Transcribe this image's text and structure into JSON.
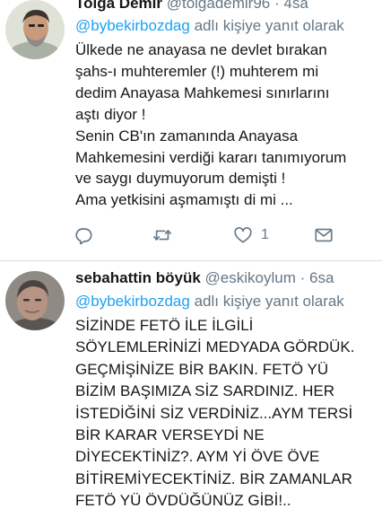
{
  "tweets": [
    {
      "display_name": "Tolga Demir",
      "handle": "@tolgademir96",
      "separator": "·",
      "age": "4sa",
      "reply_to": "@bybekirbozdag",
      "reply_suffix": " adlı kişiye yanıt olarak",
      "lines": [
        "Ülkede ne anayasa ne devlet bırakan",
        "şahs-ı muhteremler (!) muhterem mi",
        "dedim Anayasa Mahkemesi sınırlarını",
        "aştı diyor !",
        "Senin CB'ın zamanında Anayasa",
        "Mahkemesini verdiği kararı tanımıyorum",
        "ve saygı duymuyorum demişti !",
        "Ama yetkisini aşmamıştı di mi ..."
      ],
      "actions": {
        "reply_icon": "reply-icon",
        "retweet_icon": "retweet-icon",
        "like_icon": "heart-icon",
        "like_count": "1",
        "dm_icon": "mail-icon"
      }
    },
    {
      "display_name": "sebahattin böyük",
      "handle": "@eskikoylum",
      "separator": "·",
      "age": "6sa",
      "reply_to": "@bybekirbozdag",
      "reply_suffix": " adlı kişiye yanıt olarak",
      "lines": [
        "SİZİNDE FETÖ İLE İLGİLİ",
        "SÖYLEMLERİNİZİ MEDYADA GÖRDÜK.",
        "GEÇMİŞİNİZE BİR BAKIN. FETÖ YÜ",
        "BİZİM BAŞIMIZA SİZ SARDINIZ. HER",
        "İSTEDİĞİNİ SİZ VERDİNİZ...AYM TERSİ",
        "BİR KARAR VERSEYDİ NE",
        "DİYECEKTİNİZ?. AYM Yİ ÖVE ÖVE",
        "BİTİREMİYECEKTİNİZ. BİR ZAMANLAR",
        "FETÖ YÜ ÖVDÜĞÜNÜZ GİBİ!.."
      ]
    }
  ],
  "colors": {
    "accent": "#1da1f2",
    "secondary_text": "#657786",
    "primary_text": "#14171a",
    "divider": "#d7dde2"
  }
}
